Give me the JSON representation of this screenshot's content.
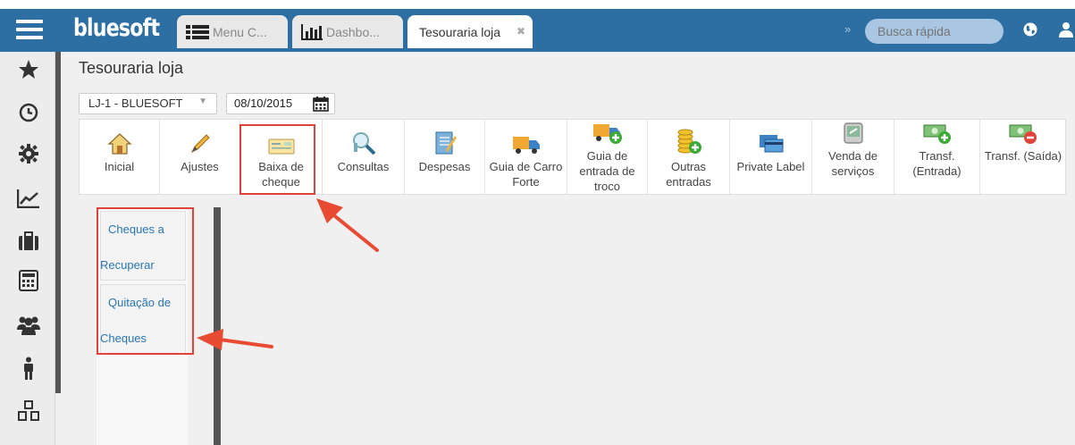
{
  "app": {
    "logo": "bluesoft",
    "tabs": [
      {
        "label": "Menu C...",
        "active": false
      },
      {
        "label": "Dashbo...",
        "active": false
      },
      {
        "label": "Tesouraria loja",
        "active": true
      }
    ],
    "search_placeholder": "Busca rápida"
  },
  "sidebar": {
    "items": [
      "star-icon",
      "clock-icon",
      "gear-icon",
      "chart-icon",
      "briefcase-icon",
      "calculator-icon",
      "users-icon",
      "person-icon",
      "cubes-icon"
    ]
  },
  "page": {
    "title": "Tesouraria loja",
    "store": "LJ-1 - BLUESOFT",
    "date": "08/10/2015"
  },
  "toolbar": {
    "buttons": [
      {
        "label": "Inicial",
        "icon": "house-icon"
      },
      {
        "label": "Ajustes",
        "icon": "pencil-icon"
      },
      {
        "label": "Baixa de cheque",
        "icon": "cheque-icon"
      },
      {
        "label": "Consultas",
        "icon": "magnifier-icon"
      },
      {
        "label": "Despesas",
        "icon": "notebook-icon"
      },
      {
        "label": "Guia de Carro Forte",
        "icon": "truck-icon"
      },
      {
        "label": "Guia de entrada de troco",
        "icon": "truck-plus-icon"
      },
      {
        "label": "Outras entradas",
        "icon": "coins-plus-icon"
      },
      {
        "label": "Private Label",
        "icon": "card-icon"
      },
      {
        "label": "Venda de serviços",
        "icon": "register-icon"
      },
      {
        "label": "Transf. (Entrada)",
        "icon": "money-plus-icon"
      },
      {
        "label": "Transf. (Saída)",
        "icon": "money-minus-icon"
      }
    ]
  },
  "submenu": {
    "items": [
      {
        "line1": "Cheques a",
        "line2": "Recuperar"
      },
      {
        "line1": "Quitação de",
        "line2": "Cheques"
      }
    ]
  },
  "colors": {
    "header": "#2d6fa3",
    "link": "#2a75b3",
    "highlight": "#e0433a"
  }
}
